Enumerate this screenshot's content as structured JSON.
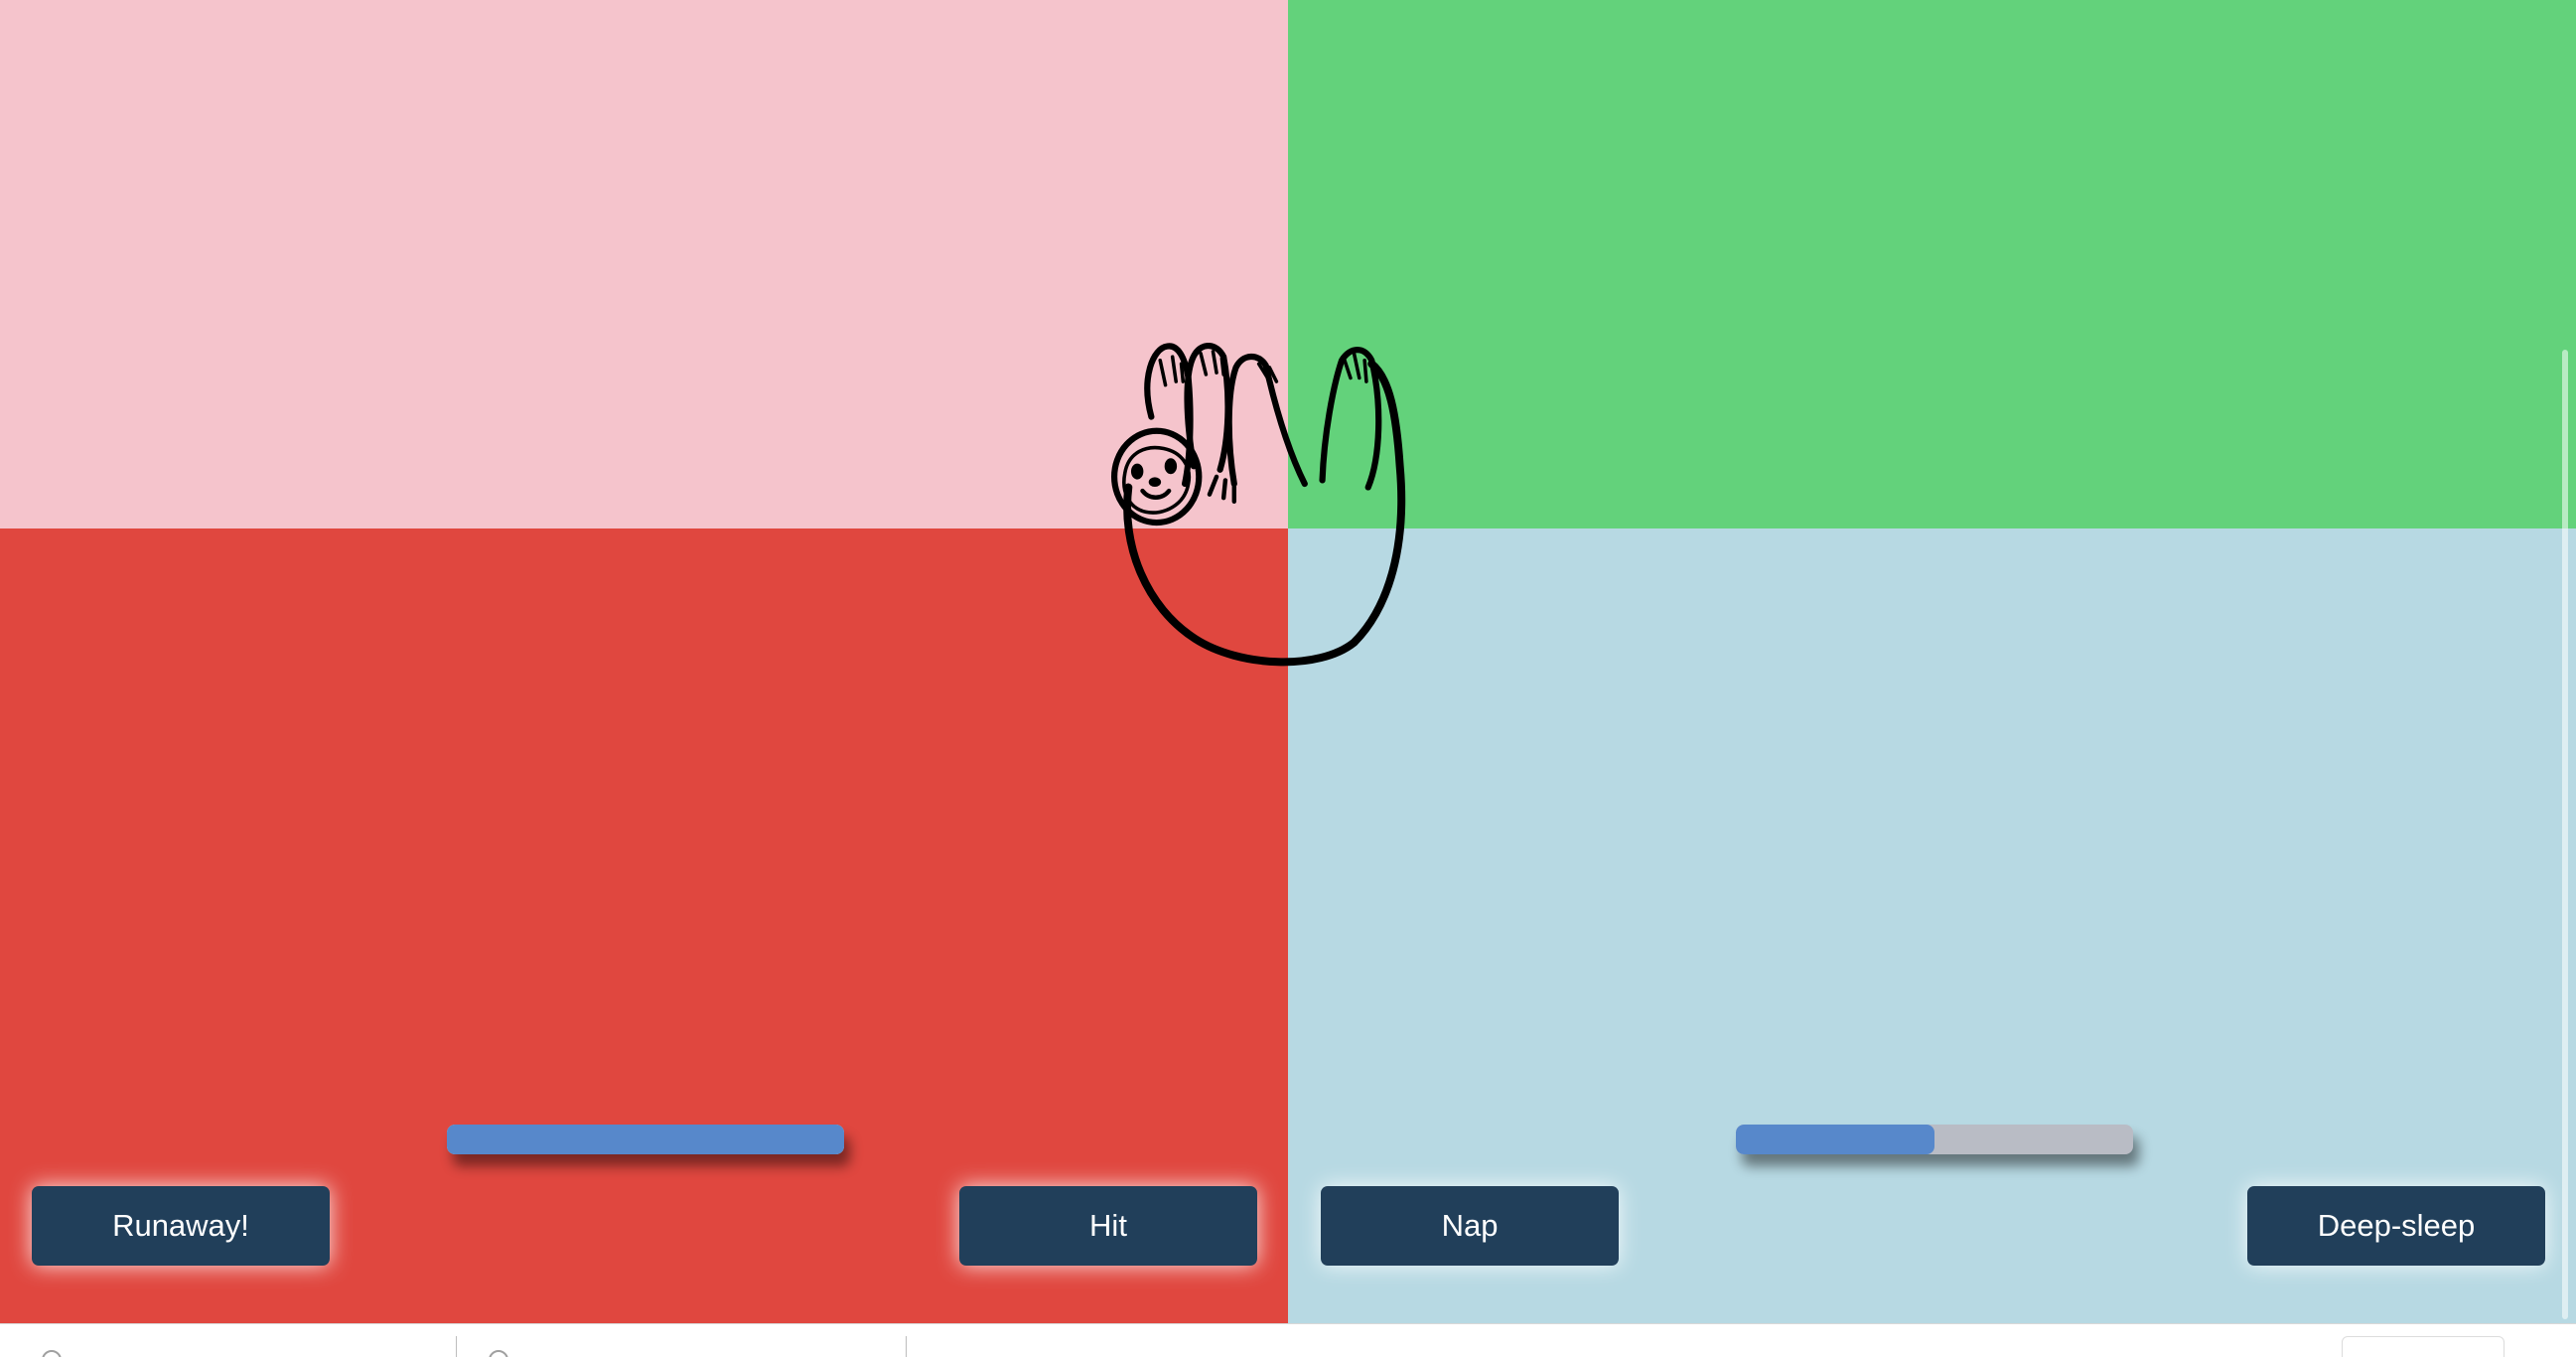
{
  "colors": {
    "top_left": "#f5c4cc",
    "top_right": "#63d27b",
    "bottom_left": "#e0473f",
    "bottom_right": "#b7d9e3",
    "button_bg": "#213f5a",
    "bar_fill": "#5788cb",
    "bar_track": "#b9bcc5"
  },
  "game": {
    "character_icon": "sloth-icon",
    "player_health": {
      "fraction": 1.0
    },
    "opponent_health": {
      "fraction": 0.5
    }
  },
  "buttons": {
    "runaway": "Runaway!",
    "hit": "Hit",
    "nap": "Nap",
    "deep_sleep": "Deep-sleep"
  }
}
